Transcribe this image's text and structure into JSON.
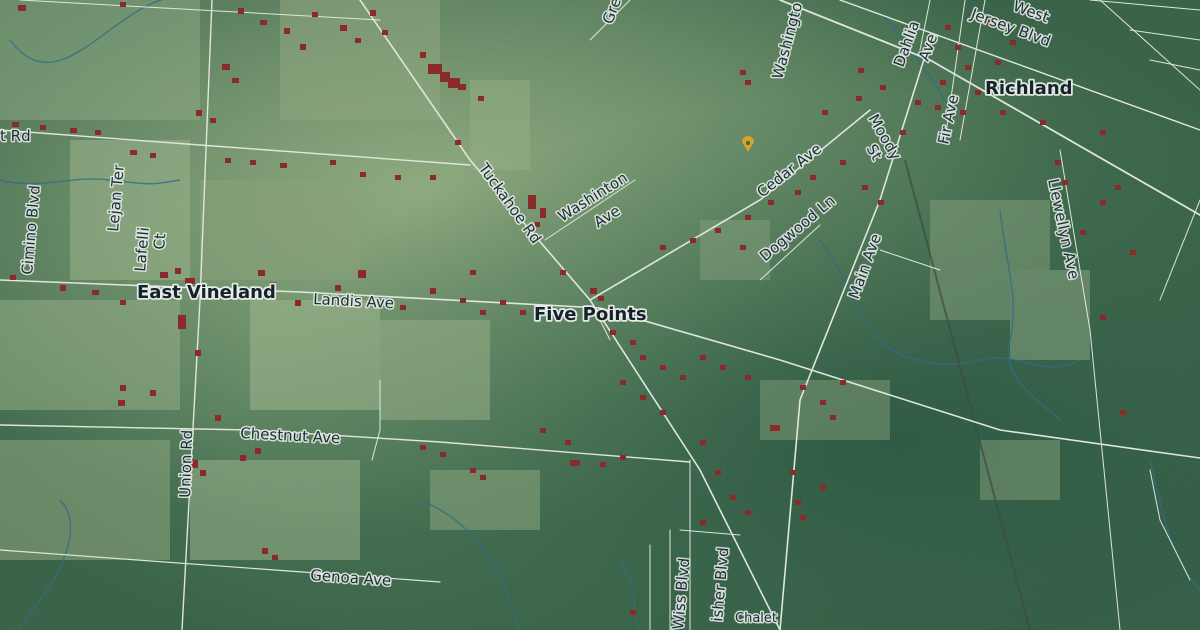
{
  "map": {
    "places": {
      "east_vineland": "East Vineland",
      "five_points": "Five Points",
      "richland": "Richland"
    },
    "roads": {
      "landis": "Landis Ave",
      "chestnut": "Chestnut Ave",
      "genoa": "Genoa Ave",
      "union": "Union Rd",
      "tuckahoe": "Tuckahoe Rd",
      "washinton": "Washinton",
      "washinton_ave": "Ave",
      "cedar": "Cedar Ave",
      "dogwood": "Dogwood Ln",
      "main": "Main Ave",
      "llewellyn": "Llewellyn Ave",
      "moody": "Moody",
      "moody_st": "St",
      "fir": "Fir Ave",
      "dahlia": "Dahlia",
      "dahlia_ave": "Ave",
      "west": "West",
      "jersey": "Jersey Blvd",
      "washington_top": "Washingto",
      "cimino": "Cimino Blvd",
      "lejan": "Lejan Ter",
      "lafelli": "Lafelli",
      "lafelli_ct": "Ct",
      "rd_left": "t Rd",
      "wiss": "Wiss Blvd",
      "fisher": "isher Blvd",
      "chalet": "Chalet",
      "gre": "Gre"
    },
    "colors": {
      "base": "#3f6b4f",
      "field": "#8aa781",
      "road": "#dfe6dc",
      "building": "#8b2a2a"
    }
  }
}
